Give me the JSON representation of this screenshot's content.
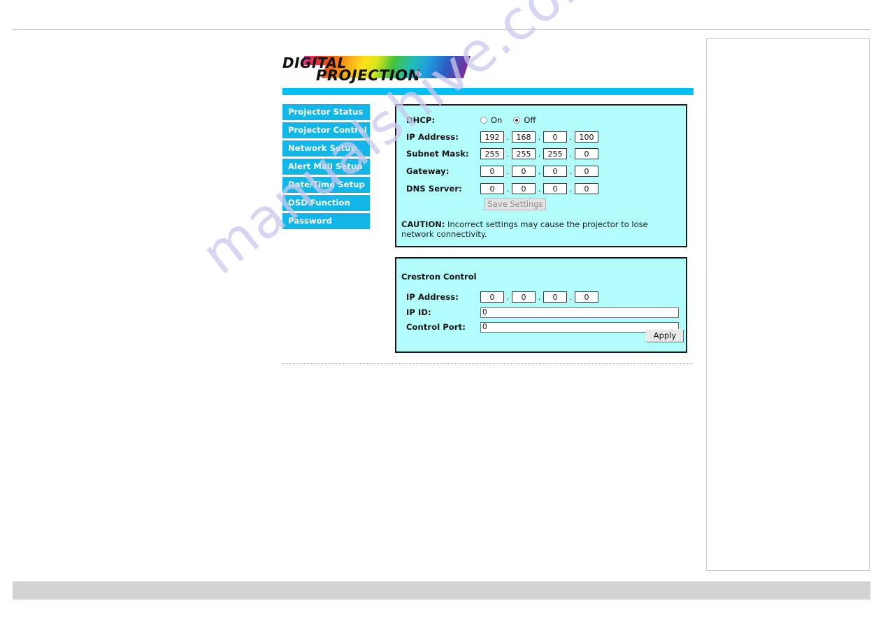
{
  "brand": {
    "logo_top": "DIGITAL",
    "logo_bottom": "PROJECTION"
  },
  "watermark": {
    "text": "manualshive.com",
    "color": "#c9c9ee"
  },
  "colors": {
    "accent_bar": "#00bff2",
    "nav_item": "#12b7e8",
    "panel_bg": "#b2fcfc",
    "footer_band": "#d2d3d5"
  },
  "sidebar": {
    "items": [
      {
        "label": "Projector Status"
      },
      {
        "label": "Projector Control"
      },
      {
        "label": "Network Setup"
      },
      {
        "label": "Alert Mail Setup"
      },
      {
        "label": "Date/Time Setup"
      },
      {
        "label": "OSD Function"
      },
      {
        "label": "Password"
      }
    ]
  },
  "network_panel": {
    "dhcp": {
      "label": "DHCP:",
      "options": [
        {
          "label": "On",
          "selected": false
        },
        {
          "label": "Off",
          "selected": true
        }
      ],
      "selected": "Off"
    },
    "ip_address": {
      "label": "IP Address:",
      "octets": [
        "192",
        "168",
        "0",
        "100"
      ]
    },
    "subnet_mask": {
      "label": "Subnet Mask:",
      "octets": [
        "255",
        "255",
        "255",
        "0"
      ]
    },
    "gateway": {
      "label": "Gateway:",
      "octets": [
        "0",
        "0",
        "0",
        "0"
      ]
    },
    "dns_server": {
      "label": "DNS Server:",
      "octets": [
        "0",
        "0",
        "0",
        "0"
      ]
    },
    "save_button": "Save Settings",
    "caution_prefix": "CAUTION:",
    "caution_text": " Incorrect settings may cause the projector to lose network connectivity."
  },
  "crestron_panel": {
    "title": "Crestron Control",
    "ip_address": {
      "label": "IP Address:",
      "octets": [
        "0",
        "0",
        "0",
        "0"
      ]
    },
    "ip_id": {
      "label": "IP ID:",
      "value": "0"
    },
    "control_port": {
      "label": "Control Port:",
      "value": "0"
    },
    "apply_button": "Apply"
  },
  "separator": {
    "octet_dot": "."
  }
}
